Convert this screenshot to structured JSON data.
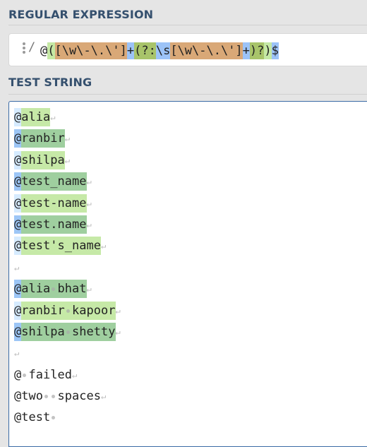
{
  "regex_section": {
    "title": "REGULAR EXPRESSION",
    "delimiter": "/",
    "grip_icon": "drag-handle-icon",
    "tokens": [
      {
        "text": "@",
        "type": "plain"
      },
      {
        "text": "(",
        "type": "group"
      },
      {
        "text": "[\\w\\-\\.\\']",
        "type": "class"
      },
      {
        "text": "+",
        "type": "quant"
      },
      {
        "text": "(?:",
        "type": "ncg"
      },
      {
        "text": "\\s",
        "type": "escape"
      },
      {
        "text": "[\\w\\-\\.\\']",
        "type": "class"
      },
      {
        "text": "+",
        "type": "quant"
      },
      {
        "text": ")?",
        "type": "ncg"
      },
      {
        "text": ")",
        "type": "group"
      },
      {
        "text": "$",
        "type": "anchor"
      }
    ]
  },
  "test_section": {
    "title": "TEST STRING",
    "lines": [
      {
        "at": "@",
        "body": "alia",
        "match": 1,
        "eol": true
      },
      {
        "at": "@",
        "body": "ranbir",
        "match": 2,
        "eol": true
      },
      {
        "at": "@",
        "body": "shilpa",
        "match": 1,
        "eol": true
      },
      {
        "at": "@",
        "body": "test_name",
        "match": 2,
        "eol": true
      },
      {
        "at": "@",
        "body": "test-name",
        "match": 1,
        "eol": true
      },
      {
        "at": "@",
        "body": "test.name",
        "match": 2,
        "eol": true
      },
      {
        "at": "@",
        "body": "test's_name",
        "match": 1,
        "eol": true
      },
      {
        "at": "",
        "body": "",
        "match": 0,
        "eol": true
      },
      {
        "at": "@",
        "body": "alia bhat",
        "match": 2,
        "eol": true
      },
      {
        "at": "@",
        "body": "ranbir kapoor",
        "match": 1,
        "eol": true
      },
      {
        "at": "@",
        "body": "shilpa shetty",
        "match": 2,
        "eol": true
      },
      {
        "at": "",
        "body": "",
        "match": 0,
        "eol": true
      },
      {
        "at": "@",
        "body": " failed",
        "match": 0,
        "eol": true
      },
      {
        "at": "@",
        "body": "two  spaces",
        "match": 0,
        "eol": true
      },
      {
        "at": "@",
        "body": "test ",
        "match": 0,
        "eol": false
      }
    ],
    "newline_symbol": "↵"
  },
  "colors": {
    "match_odd_at": "#d6ebff",
    "match_odd_body": "#c6e9a7",
    "match_even_at": "#9dc6f6",
    "match_even_body": "#9fcf9f",
    "regex_group": "#c5e8a4",
    "regex_class": "#d9a877",
    "regex_quantifier": "#9cc3f7",
    "regex_noncapture": "#a8c46a"
  }
}
